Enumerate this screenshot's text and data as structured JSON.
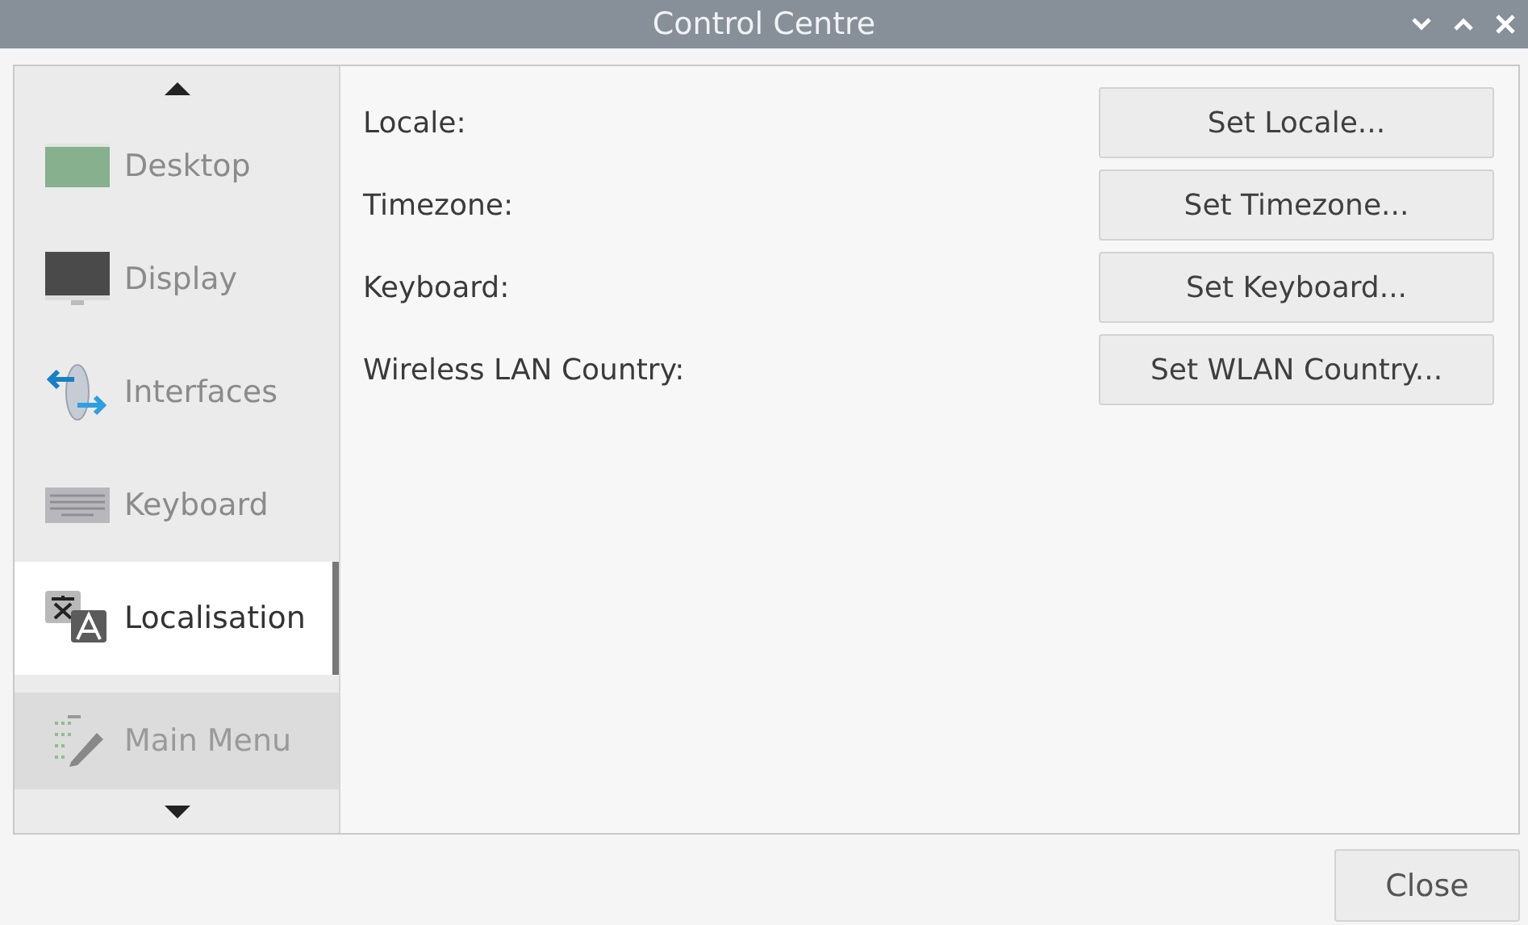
{
  "window": {
    "title": "Control Centre"
  },
  "sidebar": {
    "items": [
      {
        "label": "Desktop",
        "selected": false,
        "hovered": false
      },
      {
        "label": "Display",
        "selected": false,
        "hovered": false
      },
      {
        "label": "Interfaces",
        "selected": false,
        "hovered": false
      },
      {
        "label": "Keyboard",
        "selected": false,
        "hovered": false
      },
      {
        "label": "Localisation",
        "selected": true,
        "hovered": false
      },
      {
        "label": "Main Menu",
        "selected": false,
        "hovered": true
      }
    ]
  },
  "settings": [
    {
      "label": "Locale:",
      "button": "Set Locale..."
    },
    {
      "label": "Timezone:",
      "button": "Set Timezone..."
    },
    {
      "label": "Keyboard:",
      "button": "Set Keyboard..."
    },
    {
      "label": "Wireless LAN Country:",
      "button": "Set WLAN Country..."
    }
  ],
  "buttons": [
    "Close"
  ]
}
